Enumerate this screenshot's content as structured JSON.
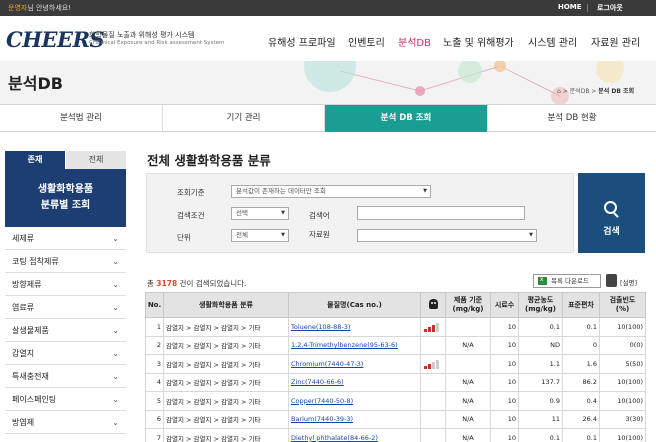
{
  "topbar": {
    "user_name": "운영자",
    "greeting_suffix": "님 안녕하세요!",
    "home": "HOME",
    "logout": "로그아웃"
  },
  "header": {
    "logo": "CHEERS",
    "logo_ko": "화학물질 노출과 위해성 평가 시스템",
    "logo_en": "CHEmical Exposure and Risk assessment System",
    "nav": [
      "유해성 프로파일",
      "인벤토리",
      "분석DB",
      "노출 및 위해평가",
      "시스템 관리",
      "자료원 관리"
    ],
    "active_nav": "분석DB"
  },
  "banner": {
    "title": "분석DB",
    "crumb1": "분석DB",
    "crumb2": "분석 DB 조회"
  },
  "tabs": [
    "분석법 관리",
    "기기 관리",
    "분석 DB 조회",
    "분석 DB 현황"
  ],
  "active_tab": "분석 DB 조회",
  "side": {
    "tab_on": "존재",
    "tab_off": "전체",
    "heading_line1": "생활화학용품",
    "heading_line2": "분류별 조회",
    "items": [
      "세제류",
      "코팅 접착제류",
      "방향제류",
      "염료류",
      "살생물제품",
      "감열지",
      "특새충전재",
      "페이스페인팅",
      "방염제"
    ]
  },
  "main": {
    "title": "전체 생활화학용품 분류",
    "filters": {
      "criteria_label": "조회기준",
      "criteria_value": "분석값이 존재하는 데이터만 조회",
      "cond_label": "검색조건",
      "cond_value": "선택",
      "keyword_label": "검색어",
      "unit_label": "단위",
      "unit_value": "전체",
      "source_label": "자료원",
      "source_value": ""
    },
    "search_button": "검색",
    "count_prefix": "총 ",
    "count_value": "3178",
    "count_suffix": " 건이 검색되었습니다.",
    "download_button": "목록 다운로드",
    "help_label": "[설명]"
  },
  "table": {
    "headers": {
      "no": "No.",
      "category": "생활화학용품 분류",
      "substance": "물질명(Cas no.)",
      "standard_line1": "제품 기준",
      "standard_line2": "(mg/kg)",
      "samples": "시료수",
      "mean_line1": "평균농도",
      "mean_line2": "(mg/kg)",
      "sd": "표준편차",
      "freq_line1": "검출빈도",
      "freq_line2": "(%)"
    },
    "rows": [
      {
        "no": "1",
        "category": "감열지 > 감열지 > 감열지 > 기타",
        "substance": "Toluene(108-88-3)",
        "hazard": 3,
        "standard": "",
        "samples": "10",
        "mean": "0.1",
        "sd": "0.1",
        "freq": "10(100)"
      },
      {
        "no": "2",
        "category": "감열지 > 감열지 > 감열지 > 기타",
        "substance": "1,2,4-Trimethylbenzene(95-63-6)",
        "hazard": 0,
        "standard": "N/A",
        "samples": "10",
        "mean": "ND",
        "sd": "0",
        "freq": "0(0)"
      },
      {
        "no": "3",
        "category": "감열지 > 감열지 > 감열지 > 기타",
        "substance": "Chromium(7440-47-3)",
        "hazard": 2,
        "standard": "",
        "samples": "10",
        "mean": "1.1",
        "sd": "1.6",
        "freq": "5(50)"
      },
      {
        "no": "4",
        "category": "감열지 > 감열지 > 감열지 > 기타",
        "substance": "Zinc(7440-66-6)",
        "hazard": 0,
        "standard": "N/A",
        "samples": "10",
        "mean": "137.7",
        "sd": "86.2",
        "freq": "10(100)"
      },
      {
        "no": "5",
        "category": "감열지 > 감열지 > 감열지 > 기타",
        "substance": "Copper(7440-50-8)",
        "hazard": 0,
        "standard": "N/A",
        "samples": "10",
        "mean": "0.9",
        "sd": "0.4",
        "freq": "10(100)"
      },
      {
        "no": "6",
        "category": "감열지 > 감열지 > 감열지 > 기타",
        "substance": "Barium(7440-39-3)",
        "hazard": 0,
        "standard": "N/A",
        "samples": "10",
        "mean": "11",
        "sd": "26.4",
        "freq": "3(30)"
      },
      {
        "no": "7",
        "category": "감열지 > 감열지 > 감열지 > 기타",
        "substance": "Diethyl phthalate(84-66-2)",
        "hazard": 0,
        "standard": "N/A",
        "samples": "10",
        "mean": "0.1",
        "sd": "0.1",
        "freq": "10(100)"
      }
    ]
  },
  "colors": {
    "accent_teal": "#1a9e93",
    "navy": "#1c3e73",
    "search_blue": "#1c4e7d",
    "highlight_red": "#d6492e",
    "nav_active": "#c8305f"
  }
}
